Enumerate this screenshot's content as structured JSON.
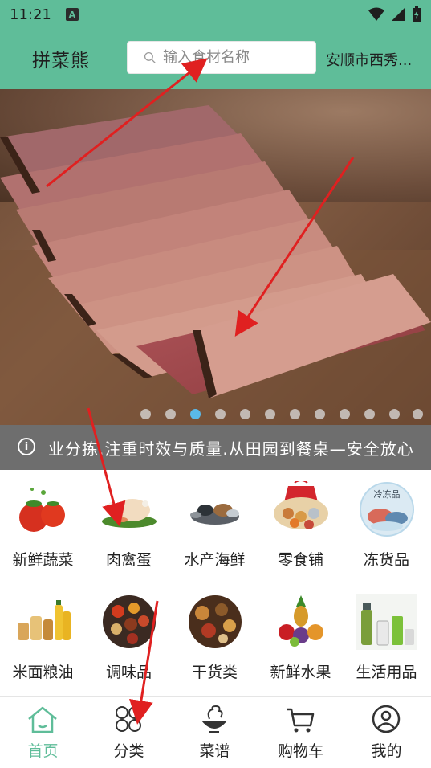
{
  "status_bar": {
    "time": "11:21",
    "notification_icon": "A"
  },
  "header": {
    "app_name": "拼菜熊",
    "search_placeholder": "输入食材名称",
    "location": "安顺市西秀..."
  },
  "banner": {
    "image_subject": "sliced-bacon",
    "slide_count": 12,
    "active_slide": 3
  },
  "notice": {
    "text": "业分拣.注重时效与质量.从田园到餐桌—安全放心"
  },
  "categories": [
    {
      "label": "新鲜蔬菜",
      "icon": "vegetables-icon"
    },
    {
      "label": "肉禽蛋",
      "icon": "meat-poultry-icon"
    },
    {
      "label": "水产海鲜",
      "icon": "seafood-icon"
    },
    {
      "label": "零食铺",
      "icon": "snacks-icon"
    },
    {
      "label": "冻货品",
      "icon": "frozen-goods-icon"
    },
    {
      "label": "米面粮油",
      "icon": "grain-oil-icon"
    },
    {
      "label": "调味品",
      "icon": "seasoning-icon"
    },
    {
      "label": "干货类",
      "icon": "dry-goods-icon"
    },
    {
      "label": "新鲜水果",
      "icon": "fruit-icon"
    },
    {
      "label": "生活用品",
      "icon": "daily-goods-icon"
    }
  ],
  "frozen_badge": "冷冻品",
  "bottom_nav": [
    {
      "label": "首页",
      "icon": "home-icon",
      "active": true
    },
    {
      "label": "分类",
      "icon": "category-icon",
      "active": false
    },
    {
      "label": "菜谱",
      "icon": "recipe-icon",
      "active": false
    },
    {
      "label": "购物车",
      "icon": "cart-icon",
      "active": false
    },
    {
      "label": "我的",
      "icon": "profile-icon",
      "active": false
    }
  ],
  "colors": {
    "brand": "#5fbd99",
    "active_dot": "#5ab9e8",
    "arrow": "#e02020"
  }
}
